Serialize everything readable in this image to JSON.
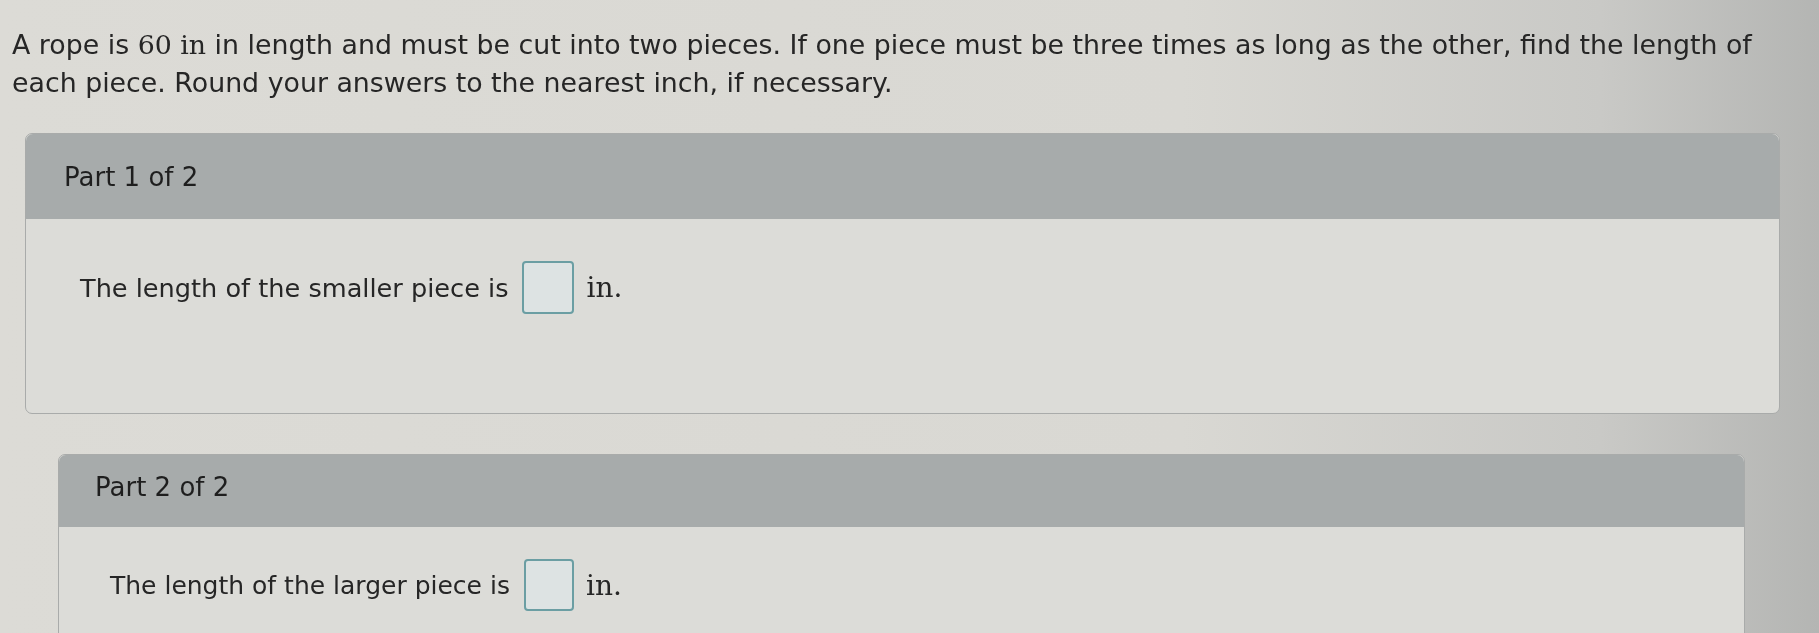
{
  "question": {
    "segments": [
      {
        "kind": "text",
        "text": "A rope is "
      },
      {
        "kind": "math",
        "text": "60 in"
      },
      {
        "kind": "text",
        "text": " in length and must be cut into two pieces. If one piece must be three times as long as the other, find the length of each piece. Round your answers to the nearest inch, if necessary."
      }
    ]
  },
  "parts": [
    {
      "title": "Part 1 of 2",
      "prompt": "The length of the smaller piece is",
      "unit": "in."
    },
    {
      "title": "Part 2 of 2",
      "prompt": "The length of the larger piece is",
      "unit": "in."
    }
  ]
}
